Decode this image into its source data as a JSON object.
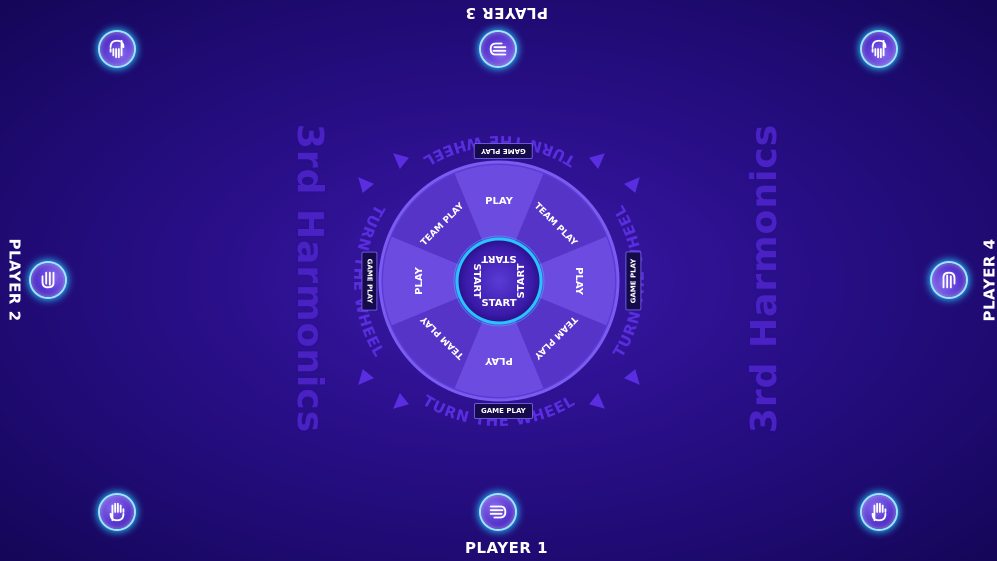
{
  "players": {
    "p1": "PLAYER 1",
    "p2": "PLAYER 2",
    "p3": "PLAYER 3",
    "p4": "PLAYER 4"
  },
  "brand": {
    "logo_left": "3rd Harmonics",
    "logo_right": "3rd Harmonics"
  },
  "wheel": {
    "center_label": "START",
    "segments": [
      "PLAY",
      "TEAM PLAY",
      "PLAY",
      "TEAM PLAY",
      "PLAY",
      "TEAM PLAY",
      "PLAY",
      "TEAM PLAY"
    ],
    "pointer_label": "GAME PLAY",
    "turn_text": "TURN THE WHEEL"
  },
  "colors": {
    "background": "#2a0f8a",
    "wheel_outer": "#5a3bd6",
    "wheel_segment_a": "#6c4be0",
    "wheel_segment_b": "#5634c8",
    "center_glow": "#29c4ff",
    "arrow_text": "#4a22c4"
  },
  "icons": {
    "hand_up": "raised-hand-icon",
    "hand_side": "pointing-hand-icon"
  }
}
